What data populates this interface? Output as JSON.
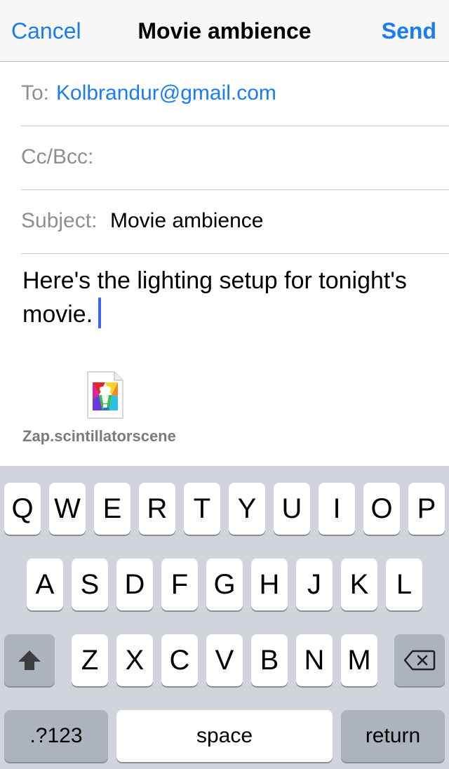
{
  "navbar": {
    "cancel_label": "Cancel",
    "title": "Movie ambience",
    "send_label": "Send"
  },
  "fields": {
    "to_label": "To:",
    "to_value": "Kolbrandur@gmail.com",
    "cc_label": "Cc/Bcc:",
    "subject_label": "Subject:",
    "subject_value": "Movie ambience"
  },
  "body": {
    "line1": "Here's the lighting setup for tonight's",
    "line2": "movie."
  },
  "attachment": {
    "filename": "Zap.scintillatorscene",
    "icon": "scene-file-icon"
  },
  "keyboard": {
    "row1": [
      "Q",
      "W",
      "E",
      "R",
      "T",
      "Y",
      "U",
      "I",
      "O",
      "P"
    ],
    "row2": [
      "A",
      "S",
      "D",
      "F",
      "G",
      "H",
      "J",
      "K",
      "L"
    ],
    "row3": [
      "Z",
      "X",
      "C",
      "V",
      "B",
      "N",
      "M"
    ],
    "shift_icon": "shift-arrow-icon",
    "delete_icon": "backspace-icon",
    "numbers_label": ".?123",
    "space_label": "space",
    "return_label": "return"
  },
  "colors": {
    "accent": "#1a7cf3",
    "keyboard_bg": "#d1d5db",
    "cursor": "#3f63f5"
  }
}
